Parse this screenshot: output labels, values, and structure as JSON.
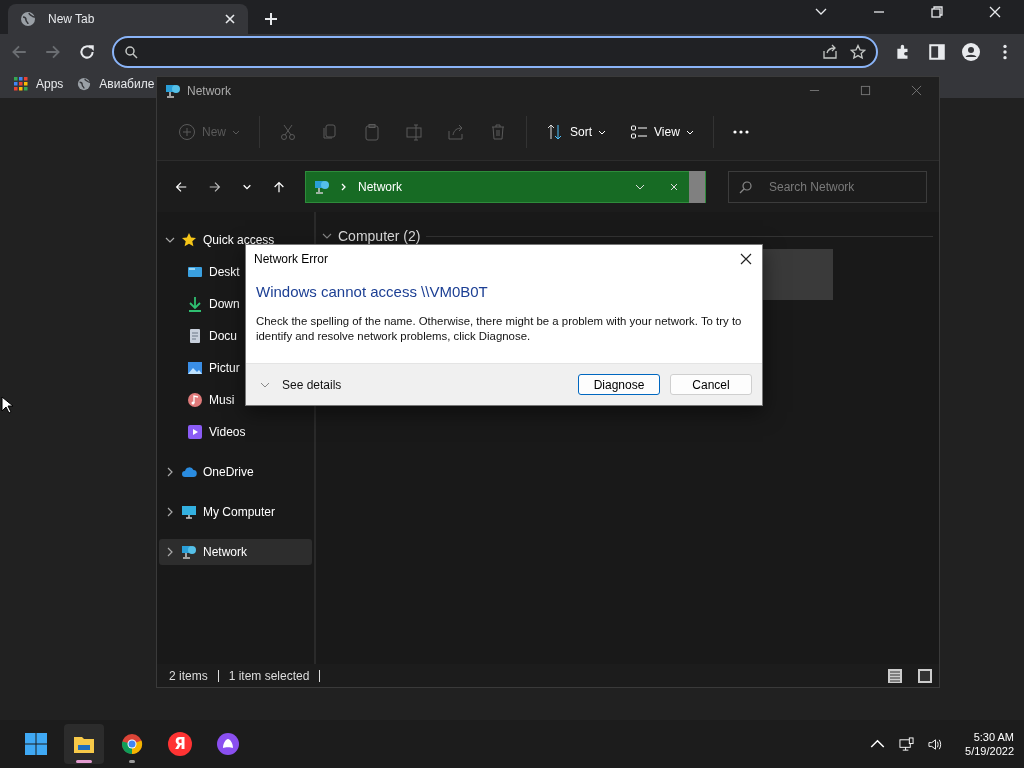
{
  "browser": {
    "tab": {
      "title": "New Tab",
      "selected": true
    },
    "bookmarks": [
      {
        "label": "Apps",
        "kind": "apps"
      },
      {
        "label": "Авиабиле",
        "kind": "globe"
      }
    ]
  },
  "explorer": {
    "title": "Network",
    "toolbar": [
      {
        "kind": "new",
        "label": "New",
        "disabled": true
      },
      {
        "kind": "cut",
        "disabled": true
      },
      {
        "kind": "copy",
        "disabled": true
      },
      {
        "kind": "paste",
        "disabled": true
      },
      {
        "kind": "rename",
        "disabled": true
      },
      {
        "kind": "share",
        "disabled": true
      },
      {
        "kind": "delete",
        "disabled": true
      },
      {
        "kind": "sort",
        "label": "Sort",
        "disabled": false
      },
      {
        "kind": "view",
        "label": "View",
        "disabled": false
      },
      {
        "kind": "more",
        "disabled": false
      }
    ],
    "address": {
      "path": "Network"
    },
    "search": {
      "placeholder": "Search Network"
    },
    "sidebar": [
      {
        "label": "Quick access",
        "kind": "star",
        "expanded": true,
        "selected": false,
        "children": [
          {
            "label": "Deskt",
            "kind": "desktop",
            "selected": false
          },
          {
            "label": "Down",
            "kind": "download",
            "selected": false
          },
          {
            "label": "Docu",
            "kind": "document",
            "selected": false
          },
          {
            "label": "Pictur",
            "kind": "picture",
            "selected": false
          },
          {
            "label": "Musi",
            "kind": "music",
            "selected": false
          },
          {
            "label": "Videos",
            "kind": "video",
            "selected": false
          }
        ]
      },
      {
        "label": "OneDrive",
        "kind": "cloud",
        "expanded": false,
        "selected": false
      },
      {
        "label": "My Computer",
        "kind": "monitor",
        "expanded": false,
        "selected": false
      },
      {
        "label": "Network",
        "kind": "network",
        "expanded": false,
        "selected": true
      }
    ],
    "group": {
      "label": "Computer (2)",
      "expanded": true
    },
    "status": [
      "2 items",
      "1 item selected"
    ]
  },
  "dialog": {
    "title": "Network Error",
    "heading": "Windows cannot access \\\\VM0B0T",
    "message": "Check the spelling of the name. Otherwise, there might be a problem with your network. To try to identify and resolve network problems, click Diagnose.",
    "details": "See details",
    "buttons": [
      {
        "label": "Diagnose",
        "default": true
      },
      {
        "label": "Cancel",
        "default": false
      }
    ]
  },
  "taskbar": {
    "apps": [
      {
        "kind": "start",
        "focused": false
      },
      {
        "kind": "explorer",
        "running": true,
        "focused": true
      },
      {
        "kind": "chrome",
        "running": true,
        "focused": false
      },
      {
        "kind": "yandex",
        "glyph": "Я",
        "focused": false
      },
      {
        "kind": "alice",
        "focused": false
      }
    ],
    "time": "5:30 AM",
    "date": "5/19/2022"
  }
}
